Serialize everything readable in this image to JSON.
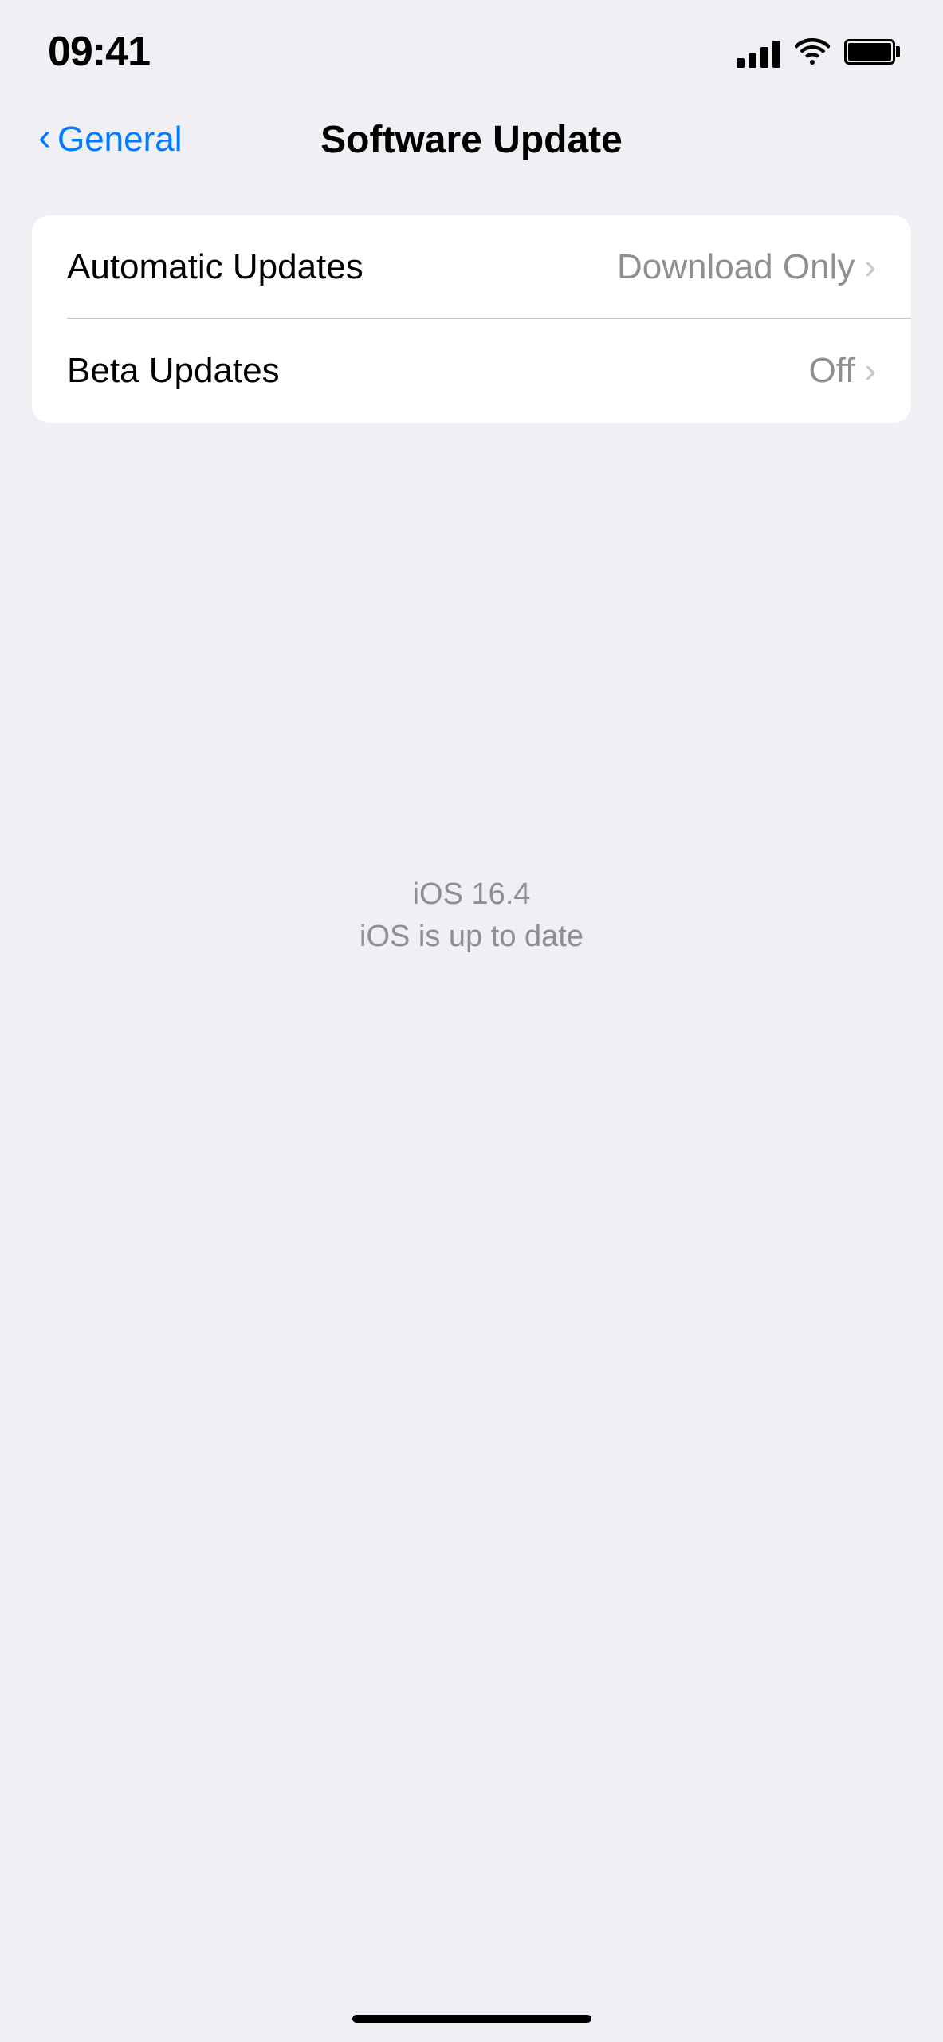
{
  "statusBar": {
    "time": "09:41"
  },
  "header": {
    "backLabel": "General",
    "title": "Software Update"
  },
  "settings": {
    "rows": [
      {
        "label": "Automatic Updates",
        "value": "Download Only",
        "hasChevron": true
      },
      {
        "label": "Beta Updates",
        "value": "Off",
        "hasChevron": true
      }
    ]
  },
  "centerInfo": {
    "version": "iOS 16.4",
    "status": "iOS is up to date"
  },
  "icons": {
    "backChevron": "‹",
    "rowChevron": "›"
  }
}
